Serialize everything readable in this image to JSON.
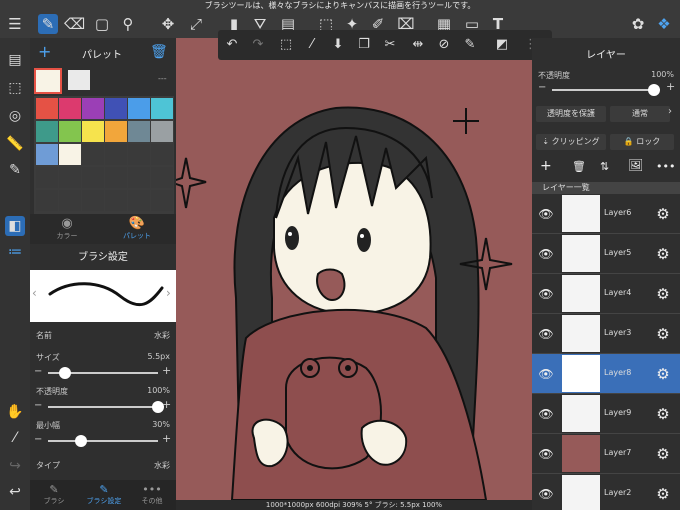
{
  "hint": "ブラシツールは、様々なブラシによりキャンバスに描画を行うツールです。",
  "palette": {
    "title": "パレット",
    "tabs": {
      "color": "カラー",
      "palette": "パレット"
    },
    "more": "---",
    "colors": [
      "#e55245",
      "#dc3a6e",
      "#9b3fb6",
      "#4051b5",
      "#4b9de9",
      "#4ec4d6",
      "#3e9a8a",
      "#83c54e",
      "#f6e34d",
      "#f2a63b",
      "#6f8895",
      "#9aa0a3",
      "#6f9cd6",
      "#f8f3e6",
      "#3a3a3a",
      "#3a3a3a",
      "#3a3a3a",
      "#3a3a3a",
      "#3a3a3a",
      "#3a3a3a",
      "#3a3a3a",
      "#3a3a3a",
      "#3a3a3a",
      "#3a3a3a",
      "#3a3a3a",
      "#3a3a3a",
      "#3a3a3a",
      "#3a3a3a",
      "#3a3a3a",
      "#3a3a3a"
    ]
  },
  "brush": {
    "title": "ブラシ設定",
    "name_label": "名前",
    "name_value": "水彩",
    "size_label": "サイズ",
    "size_value": "5.5px",
    "opacity_label": "不透明度",
    "opacity_value": "100%",
    "min_width_label": "最小幅",
    "min_width_value": "30%",
    "type_label": "タイプ",
    "type_value": "水彩",
    "size_level": 0.15,
    "opacity_level": 1.0,
    "min_width_level": 0.3
  },
  "bottom_tabs": [
    "ブラシ",
    "ブラシ設定",
    "その他"
  ],
  "layers_panel": {
    "title": "レイヤー",
    "opacity_label": "不透明度",
    "opacity_value": "100%",
    "protect_btn": "透明度を保護",
    "blend_btn": "通常",
    "clip_btn": "クリッピング",
    "lock_btn": "ロック",
    "list_header": "レイヤー一覧",
    "layers": [
      {
        "name": "Layer6",
        "selected": false,
        "thumb": "#f4f4f4"
      },
      {
        "name": "Layer5",
        "selected": false,
        "thumb": "#f4f4f4"
      },
      {
        "name": "Layer4",
        "selected": false,
        "thumb": "#f4f4f4"
      },
      {
        "name": "Layer3",
        "selected": false,
        "thumb": "#f4f4f4"
      },
      {
        "name": "Layer8",
        "selected": true,
        "thumb": "#ffffff"
      },
      {
        "name": "Layer9",
        "selected": false,
        "thumb": "#f4f4f4"
      },
      {
        "name": "Layer7",
        "selected": false,
        "thumb": "#965a59"
      },
      {
        "name": "Layer2",
        "selected": false,
        "thumb": "#f4f4f4"
      }
    ]
  },
  "status": "1000*1000px 600dpi 309% 5° ブラシ: 5.5px 100%"
}
